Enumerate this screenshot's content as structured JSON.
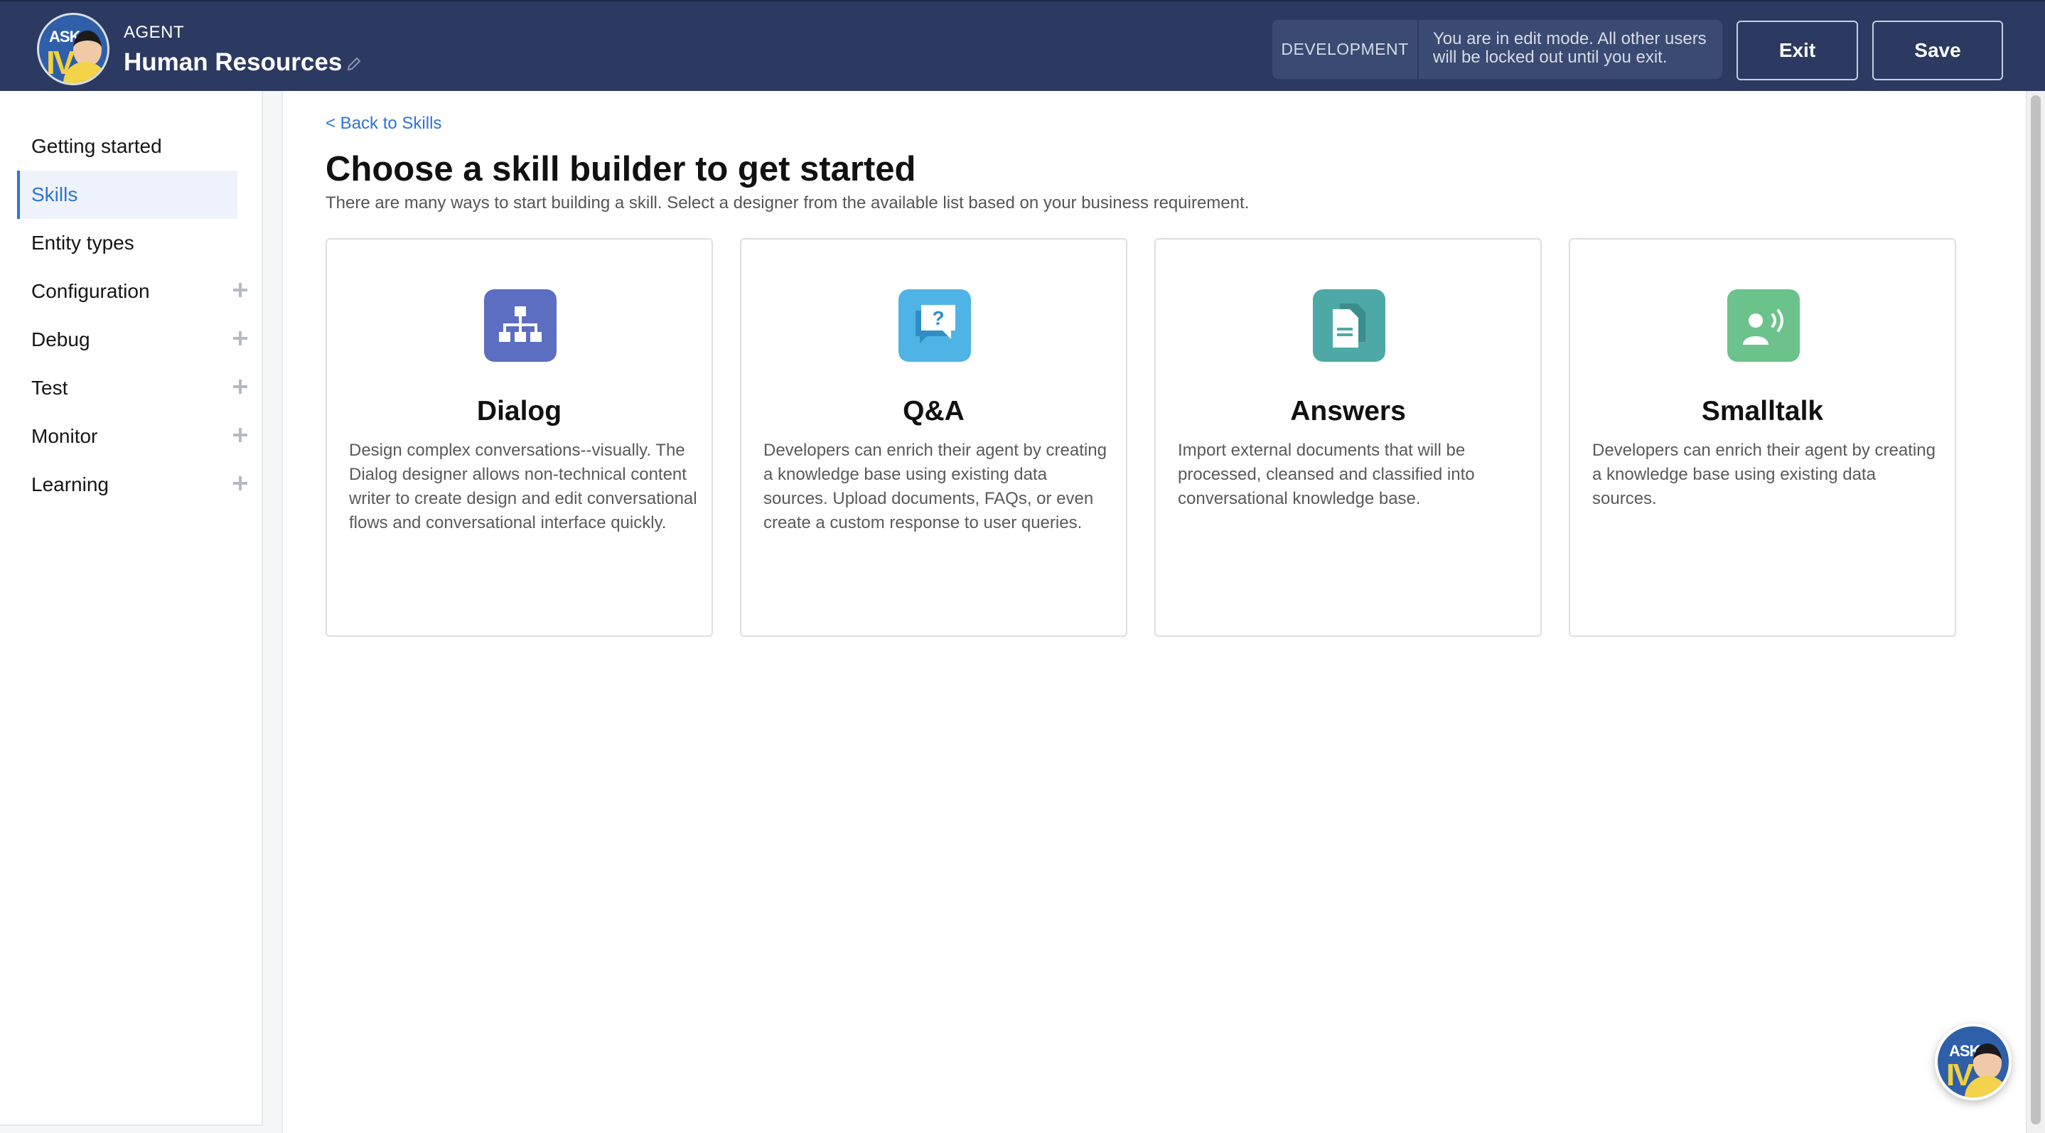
{
  "header": {
    "logo_text_top": "ASK",
    "logo_text_bottom": "IVY",
    "agent_label": "AGENT",
    "agent_name": "Human Resources",
    "environment": "DEVELOPMENT",
    "edit_message": "You are in edit mode. All other users will be locked out until you exit.",
    "exit_label": "Exit",
    "save_label": "Save"
  },
  "sidebar": {
    "items": [
      {
        "label": "Getting started",
        "expandable": false,
        "active": false
      },
      {
        "label": "Skills",
        "expandable": false,
        "active": true
      },
      {
        "label": "Entity types",
        "expandable": false,
        "active": false
      },
      {
        "label": "Configuration",
        "expandable": true,
        "active": false
      },
      {
        "label": "Debug",
        "expandable": true,
        "active": false
      },
      {
        "label": "Test",
        "expandable": true,
        "active": false
      },
      {
        "label": "Monitor",
        "expandable": true,
        "active": false
      },
      {
        "label": "Learning",
        "expandable": true,
        "active": false
      }
    ]
  },
  "main": {
    "back_link": "< Back to Skills",
    "title": "Choose a skill builder to get started",
    "subtitle": "There are many ways to start building a skill. Select a designer from the available list based on your business requirement.",
    "cards": [
      {
        "title": "Dialog",
        "icon": "org-chart-icon",
        "icon_color": "#5b6ec1",
        "description": "Design complex conversations--visually. The Dialog designer allows non-technical content writer to create design and edit conversational flows and conversational interface quickly."
      },
      {
        "title": "Q&A",
        "icon": "question-bubble-icon",
        "icon_color": "#4fb3e6",
        "description": "Developers can enrich their agent by creating a knowledge base using existing data sources. Upload documents, FAQs, or even create a custom response to user queries."
      },
      {
        "title": "Answers",
        "icon": "document-icon",
        "icon_color": "#4ea9a6",
        "description": "Import external documents that will be processed, cleansed and classified into conversational knowledge base."
      },
      {
        "title": "Smalltalk",
        "icon": "speaking-person-icon",
        "icon_color": "#6cc28b",
        "description": "Developers can enrich their agent by creating a knowledge base using existing data sources."
      }
    ]
  },
  "colors": {
    "header_bg": "#2c3a61",
    "accent": "#2f73d8"
  }
}
